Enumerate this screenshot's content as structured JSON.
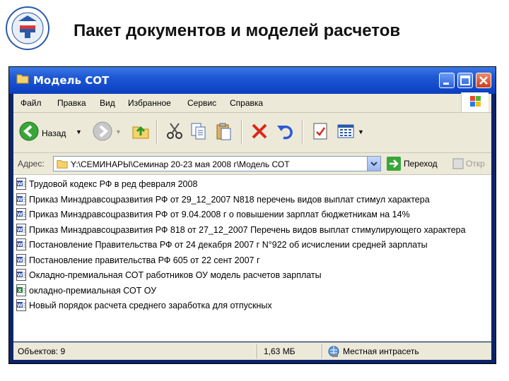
{
  "slide": {
    "title": "Пакет документов и моделей расчетов"
  },
  "window": {
    "title": "Модель СОТ"
  },
  "menu": [
    "Файл",
    "Правка",
    "Вид",
    "Избранное",
    "Сервис",
    "Справка"
  ],
  "toolbar": {
    "back_label": "Назад"
  },
  "address": {
    "label": "Адрес:",
    "path": "Y:\\СЕМИНАРЫ\\Семинар 20-23 мая 2008 г\\Модель СОТ",
    "go_label": "Переход",
    "open_label": "Откр"
  },
  "files": [
    {
      "name": "Трудовой кодекс РФ в ред февраля 2008",
      "type": "word"
    },
    {
      "name": "Приказ Минздравсоцразвития РФ от 29_12_2007 N818 перечень видов выплат стимул характера",
      "type": "word"
    },
    {
      "name": "Приказ Минздравсоцразвития РФ от 9.04.2008 г о повышении зарплат бюджетникам на 14%",
      "type": "word"
    },
    {
      "name": "Приказ Минздравсоцразвития РФ 818 от 27_12_2007 Перечень видов выплат  стимулирующего характера",
      "type": "word"
    },
    {
      "name": "Постановление Правительства РФ от 24 декабря 2007 г N°922 об исчислении средней зарплаты",
      "type": "word"
    },
    {
      "name": "Постановление правительства РФ 605 от 22 сент 2007 г",
      "type": "word"
    },
    {
      "name": "Окладно-премиальная СОТ работников ОУ модель расчетов зарплаты",
      "type": "word"
    },
    {
      "name": "окладно-премиальная СОТ ОУ",
      "type": "excel"
    },
    {
      "name": "Новый порядок расчета среднего заработка для отпускных",
      "type": "word"
    }
  ],
  "status": {
    "objects": "Объектов: 9",
    "size": "1,63 МБ",
    "zone": "Местная интрасеть"
  }
}
